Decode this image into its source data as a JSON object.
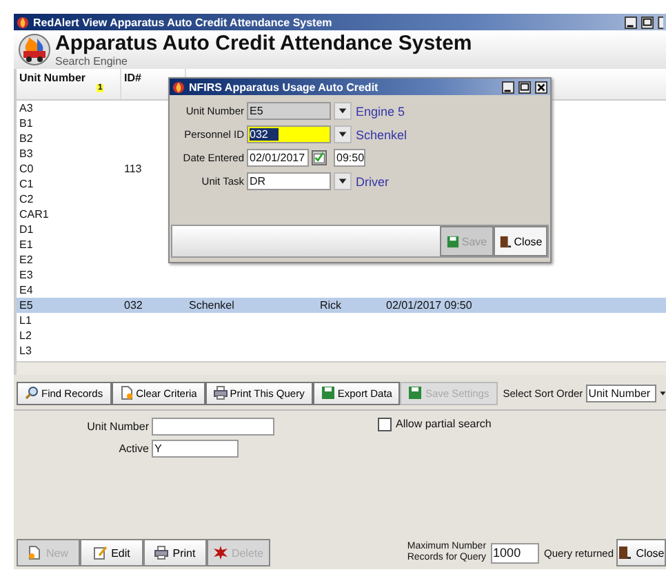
{
  "window": {
    "title": "RedAlert View Apparatus Auto Credit Attendance System"
  },
  "header": {
    "title": "Apparatus Auto Credit Attendance System",
    "subtitle": "Search Engine"
  },
  "grid": {
    "columns": [
      {
        "label": "Unit Number",
        "sort_index": "1"
      },
      {
        "label": "ID#"
      }
    ],
    "rows": [
      {
        "cells": [
          "A3",
          "",
          "",
          "",
          ""
        ],
        "selected": false
      },
      {
        "cells": [
          "B1",
          "",
          "",
          "",
          ""
        ],
        "selected": false
      },
      {
        "cells": [
          "B2",
          "",
          "",
          "",
          ""
        ],
        "selected": false
      },
      {
        "cells": [
          "B3",
          "",
          "",
          "",
          ""
        ],
        "selected": false
      },
      {
        "cells": [
          "C0",
          "113",
          "",
          "",
          ""
        ],
        "selected": false
      },
      {
        "cells": [
          "C1",
          "",
          "",
          "",
          ""
        ],
        "selected": false
      },
      {
        "cells": [
          "C2",
          "",
          "",
          "",
          ""
        ],
        "selected": false
      },
      {
        "cells": [
          "CAR1",
          "",
          "",
          "",
          ""
        ],
        "selected": false
      },
      {
        "cells": [
          "D1",
          "",
          "",
          "",
          ""
        ],
        "selected": false
      },
      {
        "cells": [
          "E1",
          "",
          "",
          "",
          ""
        ],
        "selected": false
      },
      {
        "cells": [
          "E2",
          "",
          "",
          "",
          ""
        ],
        "selected": false
      },
      {
        "cells": [
          "E3",
          "",
          "",
          "",
          ""
        ],
        "selected": false
      },
      {
        "cells": [
          "E4",
          "",
          "",
          "",
          ""
        ],
        "selected": false
      },
      {
        "cells": [
          "E5",
          "032",
          "Schenkel",
          "Rick",
          "02/01/2017  09:50"
        ],
        "selected": true
      },
      {
        "cells": [
          "L1",
          "",
          "",
          "",
          ""
        ],
        "selected": false
      },
      {
        "cells": [
          "L2",
          "",
          "",
          "",
          ""
        ],
        "selected": false
      },
      {
        "cells": [
          "L3",
          "",
          "",
          "",
          ""
        ],
        "selected": false
      }
    ]
  },
  "dialog": {
    "title": "NFIRS Apparatus Usage Auto Credit",
    "fields": [
      {
        "kind": "combo",
        "label": "Unit Number",
        "value": "E5",
        "disabled": true,
        "highlighted": false,
        "description": "Engine 5"
      },
      {
        "kind": "combo",
        "label": "Personnel ID",
        "value": "032",
        "disabled": false,
        "highlighted": true,
        "description": "Schenkel"
      },
      {
        "kind": "date",
        "label": "Date Entered",
        "value": "02/01/2017",
        "time": "09:50"
      },
      {
        "kind": "combo",
        "label": "Unit Task",
        "value": "DR",
        "disabled": false,
        "highlighted": false,
        "description": "Driver"
      }
    ],
    "buttons": [
      {
        "label": "Save",
        "disabled": true
      },
      {
        "label": "Close",
        "disabled": false
      }
    ]
  },
  "toolbar": {
    "buttons": [
      {
        "label": "Find Records",
        "disabled": false
      },
      {
        "label": "Clear Criteria",
        "disabled": false
      },
      {
        "label": "Print This Query",
        "disabled": false
      },
      {
        "label": "Export Data",
        "disabled": false
      },
      {
        "label": "Save Settings",
        "disabled": true
      }
    ],
    "sort_label": "Select Sort Order",
    "sort_value": "Unit Number"
  },
  "criteria": {
    "fields": [
      {
        "label": "Unit Number"
      },
      {
        "label": "Active",
        "value": "Y"
      }
    ],
    "partial_search": {
      "label": "Allow partial search",
      "checked": false
    }
  },
  "footer": {
    "buttons": [
      {
        "label": "New",
        "disabled": true
      },
      {
        "label": "Edit",
        "disabled": false
      },
      {
        "label": "Print",
        "disabled": false
      },
      {
        "label": "Delete",
        "disabled": true
      }
    ],
    "max_label": [
      "Maximum Number",
      "Records for Query"
    ],
    "max_value": "1000",
    "query_returned": "Query returned",
    "close": "Close"
  }
}
